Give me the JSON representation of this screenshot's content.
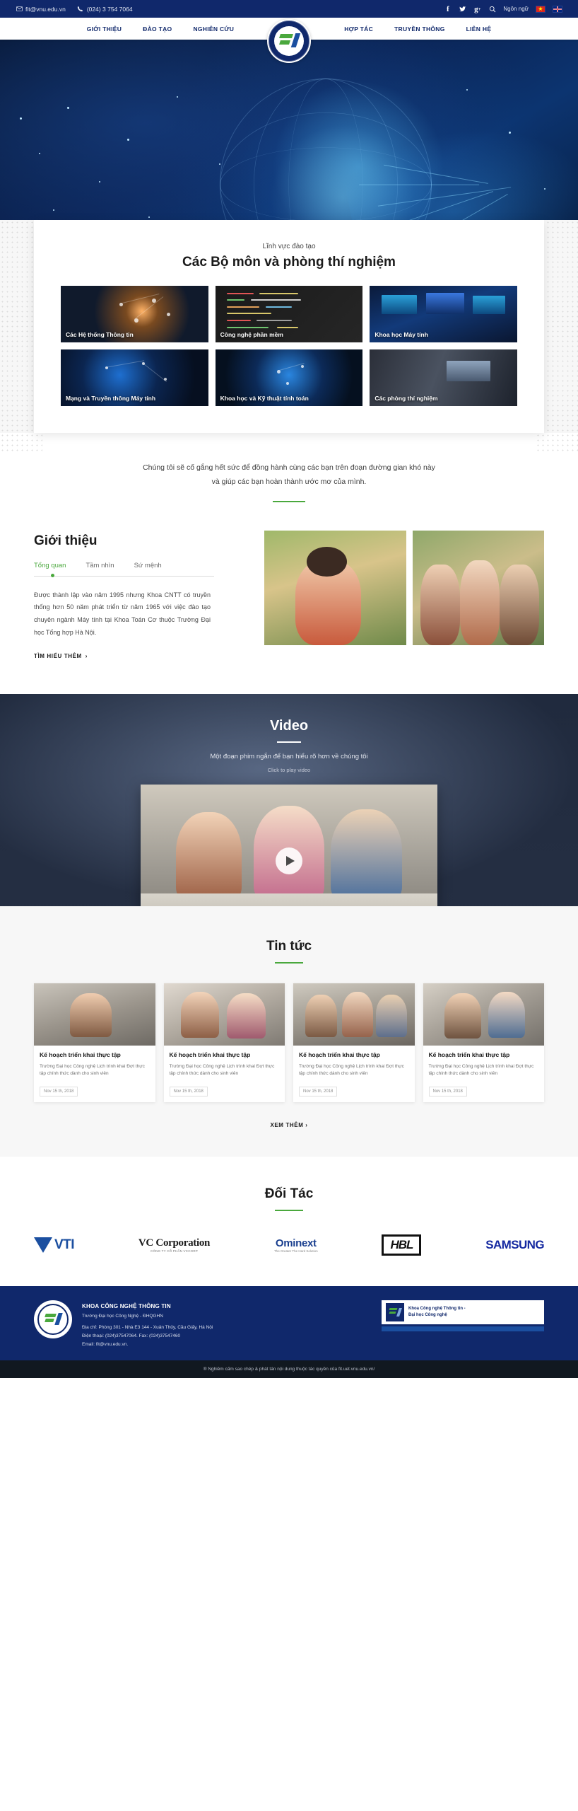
{
  "topbar": {
    "email": "fit@vnu.edu.vn",
    "phone": "(024) 3 754 7064",
    "email_icon": "envelope-icon",
    "phone_icon": "phone-icon",
    "facebook_icon": "facebook-icon",
    "twitter_icon": "twitter-icon",
    "googleplus_icon": "google-plus-icon",
    "search_icon": "search-icon",
    "lang_label": "Ngôn ngữ",
    "flag_vn": "vietnam-flag-icon",
    "flag_uk": "uk-flag-icon"
  },
  "nav": {
    "left": [
      {
        "label": "GIỚI THIỆU"
      },
      {
        "label": "ĐÀO TẠO"
      },
      {
        "label": "NGHIÊN CỨU"
      }
    ],
    "right": [
      {
        "label": "HỢP TÁC"
      },
      {
        "label": "TRUYỀN THÔNG"
      },
      {
        "label": "LIÊN HỆ"
      }
    ],
    "logo_alt": "fit-vnu-logo"
  },
  "fields": {
    "kicker": "Lĩnh vực đào tạo",
    "title": "Các Bộ môn và phòng thí nghiệm",
    "tiles": [
      {
        "label": "Các Hệ thống Thông tin"
      },
      {
        "label": "Công nghệ phần mềm"
      },
      {
        "label": "Khoa học Máy tính"
      },
      {
        "label": "Mạng và Truyền thông Máy tính"
      },
      {
        "label": "Khoa học và Kỹ thuật tính toán"
      },
      {
        "label": "Các phòng thí nghiệm"
      }
    ]
  },
  "tagline": {
    "line1": "Chúng tôi sẽ cố gắng hết sức để đồng hành cùng các bạn trên đoạn đường gian khó này",
    "line2": "và giúp các bạn hoàn thành ước mơ của mình."
  },
  "intro": {
    "heading": "Giới thiệu",
    "tabs": [
      {
        "label": "Tổng quan",
        "active": true
      },
      {
        "label": "Tầm nhìn",
        "active": false
      },
      {
        "label": "Sứ mệnh",
        "active": false
      }
    ],
    "paragraph": "Được thành lập vào năm 1995 nhưng Khoa CNTT có truyền thống hơn 50 năm phát triển từ năm 1965 với việc đào tạo chuyên ngành Máy tính tại Khoa Toán Cơ thuộc Trường Đại học Tổng hợp Hà Nội.",
    "more_label": "TÌM HIỂU THÊM",
    "more_arrow": "chevron-right-icon",
    "photo1_alt": "student-with-laptop-photo",
    "photo2_alt": "students-group-photo"
  },
  "video": {
    "heading": "Video",
    "subtitle": "Một đoạn phim ngắn để bạn hiểu rõ hơn về chúng tôi",
    "click_hint": "Click to play video",
    "play_icon": "play-icon",
    "thumbnail_alt": "students-at-desk-video-thumbnail"
  },
  "news": {
    "heading": "Tin tức",
    "items": [
      {
        "title": "Kế hoạch triển khai thực tập",
        "desc": "Trường Đại học Công nghệ Lịch trình khai Đợt thực tập chính thức dành cho sinh viên",
        "date": "Nov 15 th, 2018",
        "image_alt": "news-photo-1"
      },
      {
        "title": "Kế hoạch triển khai thực tập",
        "desc": "Trường Đại học Công nghệ Lịch trình khai Đợt thực tập chính thức dành cho sinh viên",
        "date": "Nov 15 th, 2018",
        "image_alt": "news-photo-2"
      },
      {
        "title": "Kế hoạch triển khai thực tập",
        "desc": "Trường Đại học Công nghệ Lịch trình khai Đợt thực tập chính thức dành cho sinh viên",
        "date": "Nov 15 th, 2018",
        "image_alt": "news-photo-3"
      },
      {
        "title": "Kế hoạch triển khai thực tập",
        "desc": "Trường Đại học Công nghệ Lịch trình khai Đợt thực tập chính thức dành cho sinh viên",
        "date": "Nov 15 th, 2018",
        "image_alt": "news-photo-4"
      }
    ],
    "see_more": "XEM THÊM",
    "see_more_arrow": "chevron-right-icon"
  },
  "partners": {
    "heading": "Đối Tác",
    "items": [
      {
        "name": "VTI",
        "type": "vti"
      },
      {
        "name": "VC Corporation",
        "sub": "CÔNG TY CỔ PHẦN VCCORP",
        "type": "vcc"
      },
      {
        "name": "Ominext",
        "sub": "The Greater The Hard Solution",
        "type": "omi"
      },
      {
        "name": "HBL",
        "type": "hbl"
      },
      {
        "name": "SAMSUNG",
        "type": "samsung"
      }
    ]
  },
  "footer": {
    "org_name": "KHOA CÔNG NGHỆ THÔNG TIN",
    "univ": "Trường Đại học Công Nghệ - ĐHQGHN",
    "address": "Địa chỉ: Phòng 301 - Nhà E3 144 - Xuân Thủy, Cầu Giấy, Hà Nội",
    "phone": "Điện thoại: (024)37547064. Fax: (024)37547460",
    "email": "Email: fit@vnu.edu.vn.",
    "badge_title": "Khoa Công nghệ Thông tin -",
    "badge_sub": "Đại học Công nghệ",
    "badge_logo_alt": "fit-badge-logo",
    "copyright": "® Nghiêm cấm sao chép & phát tán nội dung thuộc tác quyền của fit.uet.vnu.edu.vn/"
  },
  "colors": {
    "navy": "#10286b",
    "green": "#4aa83d",
    "blue": "#1b4fa0"
  }
}
